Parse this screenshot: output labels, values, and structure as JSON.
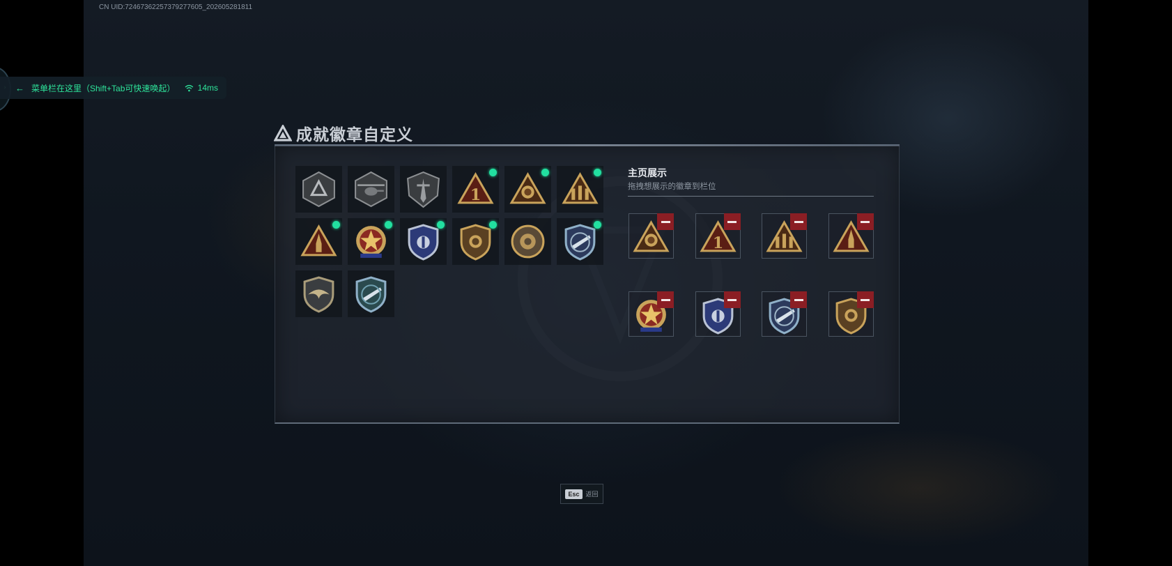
{
  "uid_text": "CN UID:72467362257379277605_202605281811",
  "menu_hint": {
    "label": "菜单栏在这里（Shift+Tab可快速唤起）",
    "ping": "14ms"
  },
  "panel": {
    "title": "成就徽章自定义"
  },
  "badges": [
    {
      "icon": "triangle-shield-badge-icon",
      "owned": false
    },
    {
      "icon": "helicopter-badge-icon",
      "owned": false
    },
    {
      "icon": "dagger-shield-badge-icon",
      "owned": false
    },
    {
      "icon": "number-one-triangle-badge-icon",
      "owned": true
    },
    {
      "icon": "lion-triangle-badge-icon",
      "owned": true
    },
    {
      "icon": "soldiers-triangle-badge-icon",
      "owned": true
    },
    {
      "icon": "missile-triangle-badge-icon",
      "owned": true
    },
    {
      "icon": "star-medal-badge-icon",
      "owned": true
    },
    {
      "icon": "police-shield-badge-icon",
      "owned": true
    },
    {
      "icon": "lion-shield-badge-icon",
      "owned": true
    },
    {
      "icon": "round-emblem-badge-icon",
      "owned": false
    },
    {
      "icon": "jet-shield-badge-icon",
      "owned": true
    },
    {
      "icon": "eagle-shield-badge-icon",
      "owned": false
    },
    {
      "icon": "jet-blue-shield-badge-icon",
      "owned": false
    }
  ],
  "showcase": {
    "title": "主页展示",
    "subtitle": "拖拽想展示的徽章到栏位",
    "slots": [
      {
        "icon": "lion-triangle-badge-icon"
      },
      {
        "icon": "number-one-triangle-badge-icon"
      },
      {
        "icon": "soldiers-triangle-badge-icon"
      },
      {
        "icon": "missile-triangle-badge-icon"
      },
      {
        "icon": "star-medal-badge-icon"
      },
      {
        "icon": "police-shield-badge-icon"
      },
      {
        "icon": "jet-shield-badge-icon"
      },
      {
        "icon": "lion-shield-badge-icon"
      }
    ]
  },
  "footer": {
    "esc_key": "Esc",
    "esc_label": "返回"
  },
  "colors": {
    "accent_green": "#22e0a0",
    "remove_red": "#8b1e24",
    "gold": "#c9a35b"
  }
}
